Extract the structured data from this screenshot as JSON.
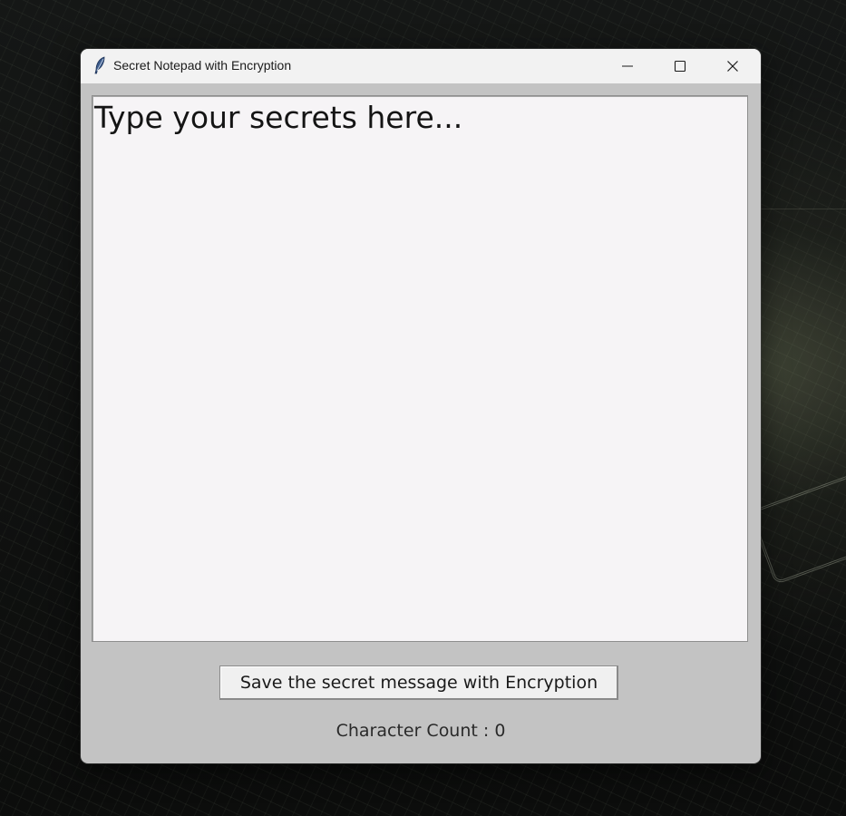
{
  "window": {
    "title": "Secret Notepad with Encryption",
    "icon": "feather-icon",
    "controls": [
      "minimize-icon",
      "maximize-icon",
      "close-icon"
    ]
  },
  "editor": {
    "text": "Type your secrets here..."
  },
  "actions": {
    "save_label": "Save the secret message with Encryption"
  },
  "status": {
    "char_count_label": "Character Count : 0"
  },
  "colors": {
    "window_bg": "#c3c3c3",
    "titlebar_bg": "#f2f2f2",
    "editor_bg": "#f6f4f6"
  }
}
